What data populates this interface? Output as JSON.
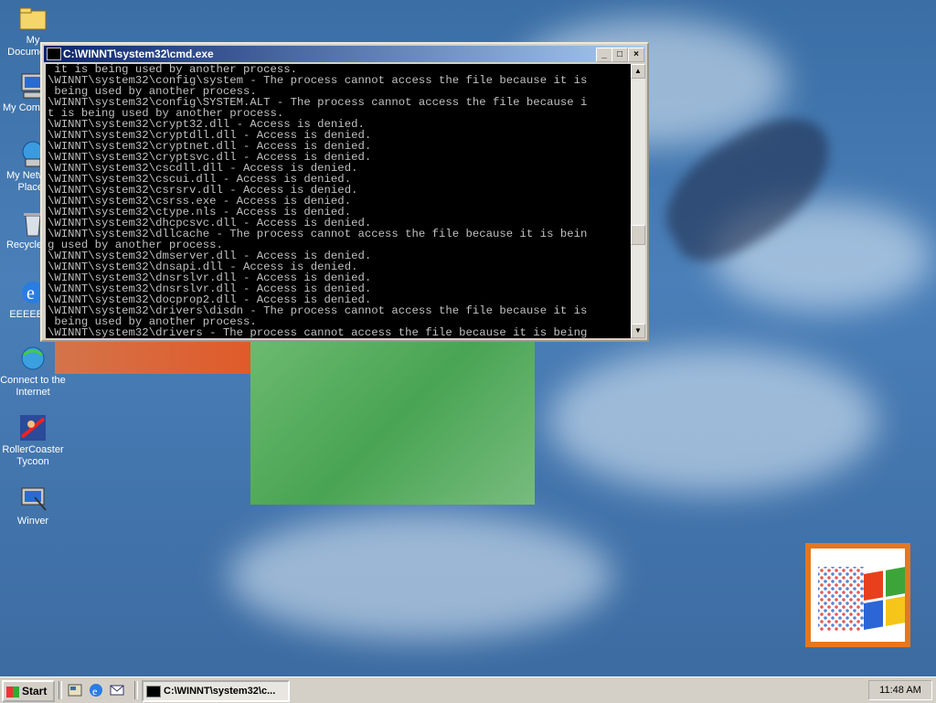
{
  "desktop": {
    "icons": [
      {
        "label": "My Documents"
      },
      {
        "label": "My Computer"
      },
      {
        "label": "My Network Places"
      },
      {
        "label": "Recycle Bin"
      },
      {
        "label": "EEEEEEE"
      },
      {
        "label": "Connect to the Internet"
      },
      {
        "label": "RollerCoaster Tycoon"
      },
      {
        "label": "Winver"
      }
    ]
  },
  "cmd_window": {
    "title": "C:\\WINNT\\system32\\cmd.exe",
    "lines": [
      " it is being used by another process.",
      "\\WINNT\\system32\\config\\system - The process cannot access the file because it is",
      " being used by another process.",
      "\\WINNT\\system32\\config\\SYSTEM.ALT - The process cannot access the file because i",
      "t is being used by another process.",
      "\\WINNT\\system32\\crypt32.dll - Access is denied.",
      "\\WINNT\\system32\\cryptdll.dll - Access is denied.",
      "\\WINNT\\system32\\cryptnet.dll - Access is denied.",
      "\\WINNT\\system32\\cryptsvc.dll - Access is denied.",
      "\\WINNT\\system32\\cscdll.dll - Access is denied.",
      "\\WINNT\\system32\\cscui.dll - Access is denied.",
      "\\WINNT\\system32\\csrsrv.dll - Access is denied.",
      "\\WINNT\\system32\\csrss.exe - Access is denied.",
      "\\WINNT\\system32\\ctype.nls - Access is denied.",
      "\\WINNT\\system32\\dhcpcsvc.dll - Access is denied.",
      "\\WINNT\\system32\\dllcache - The process cannot access the file because it is bein",
      "g used by another process.",
      "\\WINNT\\system32\\dmserver.dll - Access is denied.",
      "\\WINNT\\system32\\dnsapi.dll - Access is denied.",
      "\\WINNT\\system32\\dnsrslvr.dll - Access is denied.",
      "\\WINNT\\system32\\dnsrslvr.dll - Access is denied.",
      "\\WINNT\\system32\\docprop2.dll - Access is denied.",
      "\\WINNT\\system32\\drivers\\disdn - The process cannot access the file because it is",
      " being used by another process.",
      "\\WINNT\\system32\\drivers - The process cannot access the file because it is being"
    ]
  },
  "taskbar": {
    "start_label": "Start",
    "task_label": "C:\\WINNT\\system32\\c...",
    "clock": "11:48 AM"
  }
}
